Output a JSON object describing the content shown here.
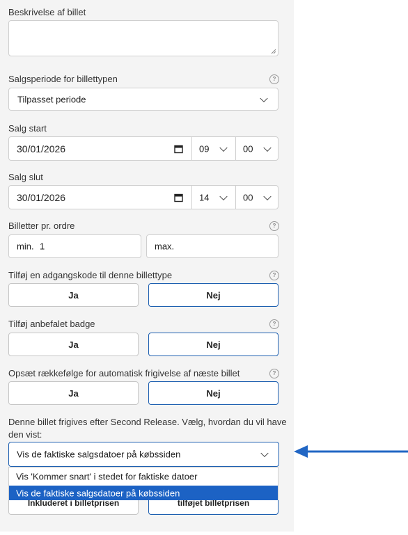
{
  "form": {
    "description": {
      "label": "Beskrivelse af billet",
      "value": ""
    },
    "sale_period": {
      "label": "Salgsperiode for billettypen",
      "value": "Tilpasset periode"
    },
    "sale_start": {
      "label": "Salg start",
      "date": "30/01/2026",
      "hour": "09",
      "minute": "00"
    },
    "sale_end": {
      "label": "Salg slut",
      "date": "30/01/2026",
      "hour": "14",
      "minute": "00"
    },
    "tickets_per_order": {
      "label": "Billetter pr. ordre",
      "min_prefix": "min.",
      "min_value": "1",
      "max_placeholder": "max."
    },
    "access_code": {
      "label": "Tilføj en adgangskode til denne billettype",
      "yes": "Ja",
      "no": "Nej",
      "selected": "Nej"
    },
    "badge": {
      "label": "Tilføj anbefalet badge",
      "yes": "Ja",
      "no": "Nej",
      "selected": "Nej"
    },
    "auto_release": {
      "label": "Opsæt rækkefølge for automatisk frigivelse af næste billet",
      "yes": "Ja",
      "no": "Nej",
      "selected": "Nej"
    },
    "release_display": {
      "label_line1": "Denne billet frigives efter Second Release. Vælg, hvordan du vil have",
      "label_line2": "den vist:",
      "value": "Vis de faktiske salgsdatoer på købssiden",
      "options": [
        "Vis 'Kommer snart' i stedet for faktiske datoer",
        "Vis de faktiske salgsdatoer på købssiden"
      ],
      "highlighted_option": "Vis de faktiske salgsdatoer på købssiden"
    },
    "fee": {
      "left_partial": "Inkluderet i billetprisen",
      "right_partial": "tilføjet billetprisen"
    }
  },
  "colors": {
    "accent": "#1d5fb0",
    "highlight": "#1c62c4",
    "arrow": "#2166c4"
  },
  "icons": {
    "help": "question-circle-icon",
    "calendar": "calendar-icon",
    "chevron": "chevron-down-icon",
    "arrow": "arrow-left-icon"
  }
}
